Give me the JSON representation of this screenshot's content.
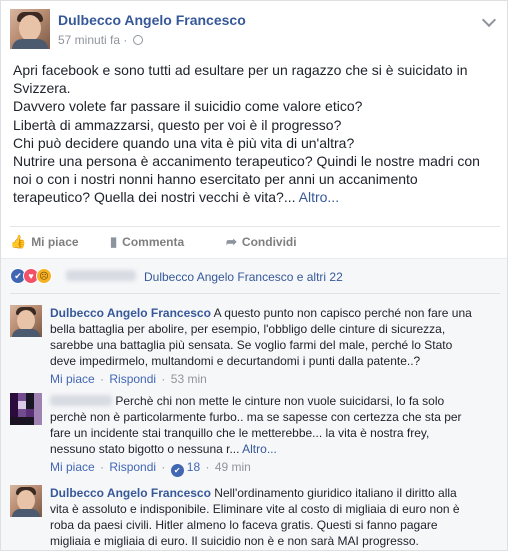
{
  "post": {
    "author": "Dulbecco Angelo Francesco",
    "time": "57 minuti fa",
    "meta_separator": "·",
    "lines": [
      "Apri facebook e sono tutti ad esultare per un ragazzo che si è suicidato in",
      "Svizzera.",
      "Davvero volete far passare il suicidio come valore etico?",
      "Libertà di ammazzarsi, questo per voi è il progresso?",
      "Chi può decidere quando una vita è più vita di un'altra?",
      "Nutrire una persona è accanimento terapeutico? Quindi le nostre madri con",
      "noi o con i nostri nonni hanno esercitato per anni un accanimento"
    ],
    "last_line": "terapeutico? Quella dei nostri vecchi è vita?...",
    "more_label": "Altro..."
  },
  "actions": {
    "like_label": "Mi piace",
    "comment_label": "Commenta",
    "share_label": "Condividi"
  },
  "reactions": {
    "summary": "Dulbecco Angelo Francesco e altri 22"
  },
  "comments": [
    {
      "author": "Dulbecco Angelo Francesco",
      "lines": [
        "A questo punto non capisco perché non fare una",
        "bella battaglia per abolire, per esempio, l'obbligo delle cinture di sicurezza,",
        "sarebbe una battaglia più sensata. Se voglio farmi del male, perché lo Stato",
        "deve impedirmelo, multandomi e decurtandomi i punti dalla patente..?"
      ],
      "like_label": "Mi piace",
      "reply_label": "Rispondi",
      "time": "53 min"
    },
    {
      "lines": [
        "Perchè chi non mette le cinture non vuole suicidarsi, lo fa solo",
        "perchè non è particolarmente furbo.. ma se sapesse con certezza che sta per",
        "fare un incidente stai tranquillo che le metterebbe... la vita è nostra frey,"
      ],
      "last_line": "nessuno stato bigotto o nessuna r...",
      "more_label": "Altro...",
      "like_label": "Mi piace",
      "reply_label": "Rispondi",
      "likes": "18",
      "time": "49 min"
    },
    {
      "author": "Dulbecco Angelo Francesco",
      "lines": [
        "Nell'ordinamento giuridico italiano il diritto alla",
        "vita è assoluto e indisponibile. Eliminare vite al costo di migliaia di euro non è",
        "roba da paesi civili. Hitler almeno lo faceva gratis. Questi si fanno pagare",
        "migliaia e migliaia di euro. Il suicidio non è e non sarà MAI progresso."
      ]
    }
  ]
}
